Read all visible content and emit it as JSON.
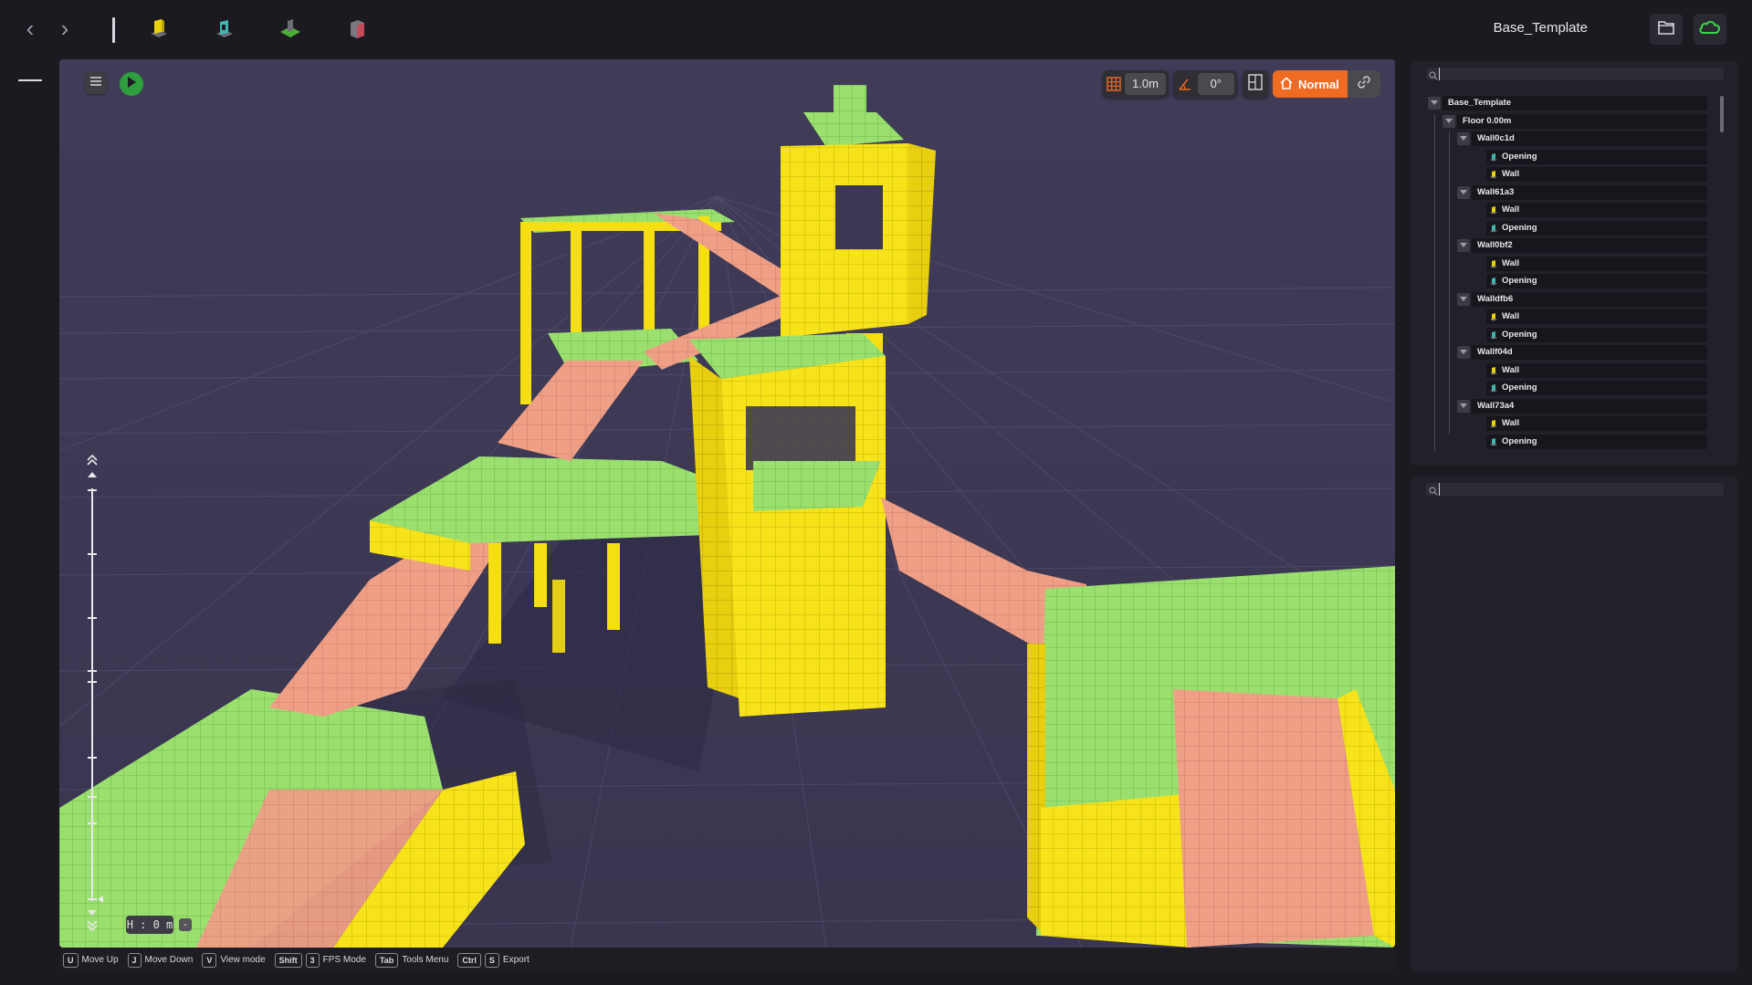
{
  "app": {
    "project_name": "Base_Template"
  },
  "topbar": {
    "back_icon": "chevron-left-icon",
    "forward_icon": "chevron-right-icon",
    "tools": [
      {
        "name": "wall-tool-icon",
        "color": "#e8d20a"
      },
      {
        "name": "opening-tool-icon",
        "color": "#3fb6b0"
      },
      {
        "name": "floor-tool-icon",
        "color": "#4cae3a"
      },
      {
        "name": "block-tool-icon",
        "color": "#c44a5a"
      }
    ],
    "folder_icon": "folder-icon",
    "cloud_icon": "cloud-icon",
    "cloud_color": "#35d64a"
  },
  "viewport_toolbar": {
    "grid_size": "1.0m",
    "angle": "0°",
    "view_mode": "Normal",
    "accent": "#ef6b22"
  },
  "height_slider": {
    "readout": "H : 0 m",
    "minus": "-"
  },
  "hints": [
    {
      "keys": [
        "U"
      ],
      "label": "Move Up"
    },
    {
      "keys": [
        "J"
      ],
      "label": "Move Down"
    },
    {
      "keys": [
        "V"
      ],
      "label": "View mode"
    },
    {
      "keys": [
        "Shift",
        "3"
      ],
      "label": "FPS Mode"
    },
    {
      "keys": [
        "Tab"
      ],
      "label": "Tools Menu"
    },
    {
      "keys": [
        "Ctrl",
        "S"
      ],
      "label": "Export"
    }
  ],
  "scene_tree": {
    "search_placeholder": "",
    "rows": [
      {
        "label": "Base_Template",
        "level": 0,
        "type": "group"
      },
      {
        "label": "Floor 0.00m",
        "level": 1,
        "type": "group"
      },
      {
        "label": "Wall0c1d",
        "level": 2,
        "type": "group"
      },
      {
        "label": "Opening",
        "level": 3,
        "type": "opening"
      },
      {
        "label": "Wall",
        "level": 3,
        "type": "wall"
      },
      {
        "label": "Wall61a3",
        "level": 2,
        "type": "group"
      },
      {
        "label": "Wall",
        "level": 3,
        "type": "wall"
      },
      {
        "label": "Opening",
        "level": 3,
        "type": "opening"
      },
      {
        "label": "Wall0bf2",
        "level": 2,
        "type": "group"
      },
      {
        "label": "Wall",
        "level": 3,
        "type": "wall"
      },
      {
        "label": "Opening",
        "level": 3,
        "type": "opening"
      },
      {
        "label": "Walldfb6",
        "level": 2,
        "type": "group"
      },
      {
        "label": "Wall",
        "level": 3,
        "type": "wall"
      },
      {
        "label": "Opening",
        "level": 3,
        "type": "opening"
      },
      {
        "label": "Wallf04d",
        "level": 2,
        "type": "group"
      },
      {
        "label": "Wall",
        "level": 3,
        "type": "wall"
      },
      {
        "label": "Opening",
        "level": 3,
        "type": "opening"
      },
      {
        "label": "Wall73a4",
        "level": 2,
        "type": "group"
      },
      {
        "label": "Wall",
        "level": 3,
        "type": "wall"
      },
      {
        "label": "Opening",
        "level": 3,
        "type": "opening"
      }
    ]
  },
  "properties_panel": {
    "search_placeholder": ""
  }
}
